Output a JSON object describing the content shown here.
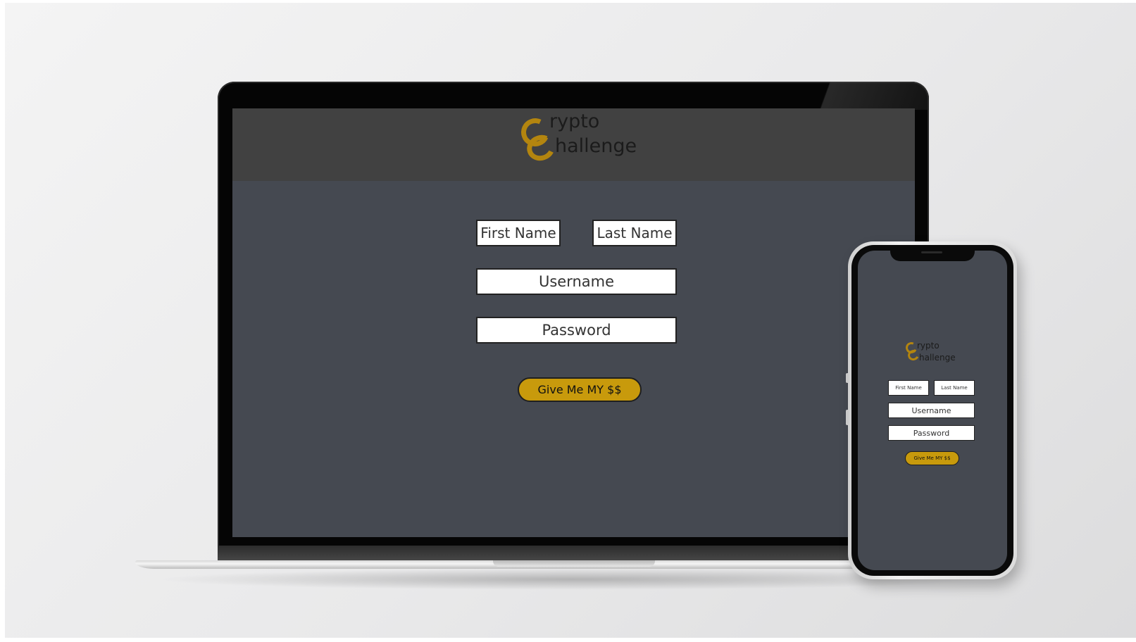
{
  "brand": {
    "logo_letter": "C",
    "line1": "rypto",
    "line2": "hallenge",
    "accent_color": "#b3850f"
  },
  "form": {
    "first_name_placeholder": "First Name",
    "last_name_placeholder": "Last Name",
    "username_placeholder": "Username",
    "password_placeholder": "Password",
    "submit_label": "Give Me MY $$",
    "button_color": "#c89a0c",
    "background_color": "#454951",
    "header_color": "#414141"
  },
  "devices": [
    "laptop",
    "phone"
  ]
}
